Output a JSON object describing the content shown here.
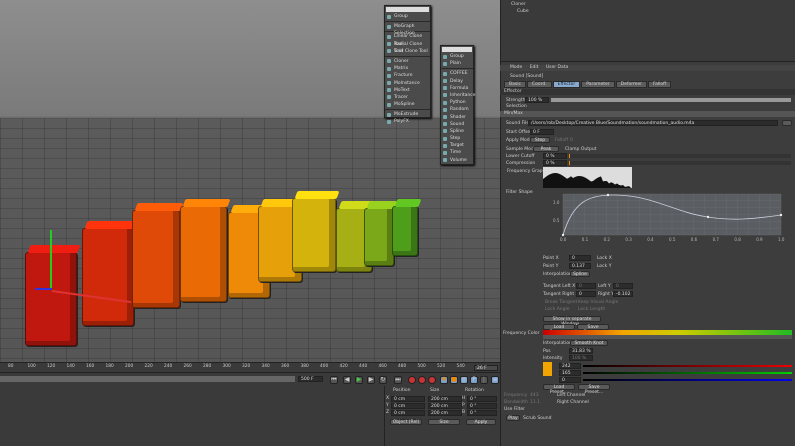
{
  "objects": [
    {
      "name": "Cloner"
    },
    {
      "name": "Cube"
    }
  ],
  "mograph_menu": {
    "items": [
      "Group",
      "MoGraph Selection",
      "Linear Clone Tool",
      "Radial Clone Tool",
      "Grid Clone Tool",
      "Cloner",
      "Matrix",
      "Fracture",
      "MoInstance",
      "MoText",
      "Tracer",
      "MoSpline",
      "MoExtrude",
      "PolyFX"
    ]
  },
  "effector_menu": {
    "items": [
      "Group",
      "Plain",
      "COFFEE",
      "Delay",
      "Formula",
      "Inheritance",
      "Python",
      "Random",
      "Shader",
      "Sound",
      "Spline",
      "Step",
      "Target",
      "Time",
      "Volume"
    ]
  },
  "attributes": {
    "menu": [
      "Mode",
      "Edit",
      "User Data"
    ],
    "title": "Sound [Sound]",
    "tabs": [
      {
        "label": "Basic",
        "active": false
      },
      {
        "label": "Coord.",
        "active": false
      },
      {
        "label": "Effector",
        "active": true
      },
      {
        "label": "Parameter",
        "active": false
      },
      {
        "label": "Deformer",
        "active": false
      },
      {
        "label": "Falloff",
        "active": false
      }
    ],
    "section": "Effector",
    "strength_label": "Strength",
    "strength": "100 %",
    "strength_value": 100,
    "selection_label": "Selection",
    "minmax_label": "Min/Max",
    "sound_file_label": "Sound File",
    "sound_file": "/Users/rob/Desktop/Creative Blue/Soundmation/soundmation_audio.m4a",
    "start_offset_label": "Start Offset",
    "start_offset": "0 F",
    "apply_mode_label": "Apply Mode",
    "apply_mode": "Step",
    "falloff_label": "Falloff",
    "falloff": "0",
    "sample_mode_label": "Sample Mode",
    "sample_mode": "Peak",
    "clamp_label": "Clamp Output",
    "lower_cutoff_label": "Lower Cutoff",
    "lower_cutoff": "0 %",
    "compression_label": "Compression",
    "compression": "0 %",
    "freq_graph_label": "Frequency Graph",
    "filter_shape_label": "Filter Shape",
    "filter_y_ticks": [
      "0.5",
      "1.0"
    ],
    "filter_x_ticks": [
      "0.0",
      "0.1",
      "0.2",
      "0.3",
      "0.4",
      "0.5",
      "0.6",
      "0.7",
      "0.8",
      "0.9",
      "1.0"
    ],
    "point_x_label": "Point X",
    "point_x": "0",
    "lock_x": "Lock X",
    "point_y_label": "Point Y",
    "point_y": "0.137",
    "lock_y": "Lock Y",
    "interp_label": "Interpolation",
    "interp": "Spline",
    "tan_lx_label": "Tangent Left X",
    "tan_lx": "0",
    "tan_ly_label": "Left Y",
    "tan_ly": "0",
    "tan_rx_label": "Tangent Right X",
    "tan_rx": "0",
    "tan_ry_label": "Right Y",
    "tan_ry": "-0.102",
    "break_tangent": "Break Tangent",
    "keep_visual": "Keep Visual Angle",
    "lock_angle": "Lock Angle",
    "lock_length": "Lock Length",
    "show_window": "Show in separate Window...",
    "load_preset": "Load Preset...",
    "save_preset": "Save Preset...",
    "freq_color_label": "Frequency Color",
    "grad_interp": "Smooth Knot",
    "pos_label": "Pos",
    "pos": "31.83 %",
    "intensity_label": "Intensity",
    "intensity": "100 %",
    "r": "242",
    "g": "165",
    "b": "0",
    "swatch": "#f2a500",
    "frequency_label": "Frequency",
    "frequency": "443",
    "bandwidth_label": "Bandwidth",
    "bandwidth": "11.1",
    "left_channel": "Left Channel",
    "right_channel": "Right Channel",
    "use_filter": "Use Filter",
    "play": "Play",
    "scrub": "Scrub Sound"
  },
  "timeline": {
    "ticks": [
      "80",
      "100",
      "120",
      "140",
      "160",
      "180",
      "200",
      "220",
      "240",
      "260",
      "280",
      "300",
      "320",
      "340",
      "360",
      "380",
      "400",
      "420",
      "440",
      "460",
      "480",
      "500",
      "520",
      "540"
    ],
    "end_frame": "500 F",
    "current": "26 F"
  },
  "coords": {
    "position": "Position",
    "size": "Size",
    "rotation": "Rotation",
    "rows": [
      {
        "axis": "X",
        "pos": "0 cm",
        "size": "200 cm",
        "rl": "H",
        "rot": "0 °"
      },
      {
        "axis": "Y",
        "pos": "0 cm",
        "size": "200 cm",
        "rl": "P",
        "rot": "0 °"
      },
      {
        "axis": "Z",
        "pos": "0 cm",
        "size": "200 cm",
        "rl": "B",
        "rot": "0 °"
      }
    ],
    "mode": "Object (Rel)",
    "size_mode": "Size",
    "apply": "Apply"
  }
}
